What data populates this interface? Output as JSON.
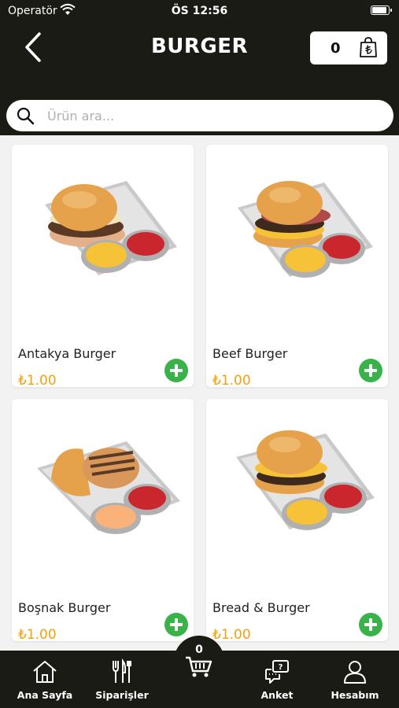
{
  "status_bar": {
    "carrier": "Operatör",
    "time": "ÖS 12:56"
  },
  "header": {
    "title": "BURGER",
    "cart_count": "0"
  },
  "search": {
    "placeholder": "Ürün ara..."
  },
  "products": [
    {
      "name": "Antakya Burger",
      "price": "₺1.00"
    },
    {
      "name": "Beef Burger",
      "price": "₺1.00"
    },
    {
      "name": "Boşnak Burger",
      "price": "₺1.00"
    },
    {
      "name": "Bread & Burger",
      "price": "₺1.00"
    }
  ],
  "nav": {
    "cart_count": "0",
    "items": [
      {
        "label": "Ana Sayfa",
        "icon": "home-icon"
      },
      {
        "label": "Siparişler",
        "icon": "cutlery-icon"
      },
      {
        "label": "Anket",
        "icon": "survey-chat-icon"
      },
      {
        "label": "Hesabım",
        "icon": "user-icon"
      }
    ]
  },
  "colors": {
    "dark": "#1b1b16",
    "price": "#f2a20b",
    "add": "#3ab24a",
    "background": "#f2f2f2"
  }
}
